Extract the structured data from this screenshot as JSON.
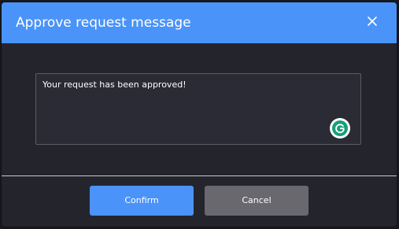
{
  "dialog": {
    "title": "Approve request message",
    "close_icon": "close-icon",
    "message_value": "Your request has been approved!",
    "grammarly_icon": "grammarly-icon",
    "confirm_label": "Confirm",
    "cancel_label": "Cancel"
  },
  "colors": {
    "header": "#4a93f8",
    "confirm_button": "#4a93f8",
    "cancel_button": "#68686e",
    "dialog_body": "#24242d",
    "grammarly": "#15a07a"
  }
}
